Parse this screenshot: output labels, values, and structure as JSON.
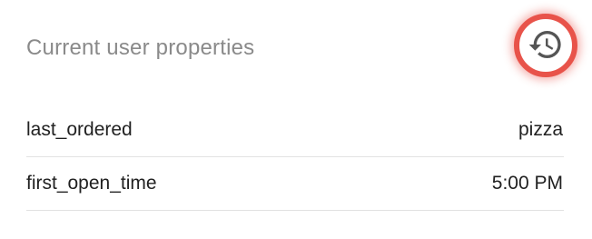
{
  "header": {
    "title": "Current user properties",
    "history_button": {
      "icon": "history-icon",
      "highlight_color": "#e8534a"
    }
  },
  "properties": [
    {
      "key": "last_ordered",
      "value": "pizza"
    },
    {
      "key": "first_open_time",
      "value": "5:00 PM"
    }
  ],
  "colors": {
    "title_text": "#8a8a8a",
    "body_text": "#212121",
    "divider": "#e2e2e2",
    "icon": "#555555"
  }
}
